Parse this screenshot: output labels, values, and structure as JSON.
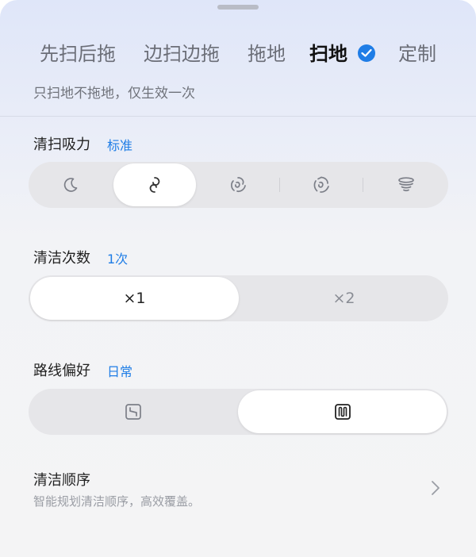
{
  "tabs": [
    {
      "label": "先扫后拖",
      "active": false
    },
    {
      "label": "边扫边拖",
      "active": false
    },
    {
      "label": "拖地",
      "active": false
    },
    {
      "label": "扫地",
      "active": true
    },
    {
      "label": "定制",
      "active": false
    }
  ],
  "mode_hint": "只扫地不拖地，仅生效一次",
  "suction": {
    "label": "清扫吸力",
    "value": "标准",
    "options": [
      {
        "icon": "moon-icon",
        "active": false
      },
      {
        "icon": "swirl-standard-icon",
        "active": true
      },
      {
        "icon": "swirl-strong-icon",
        "active": false
      },
      {
        "icon": "swirl-turbo-icon",
        "active": false
      },
      {
        "icon": "tornado-max-icon",
        "active": false
      }
    ]
  },
  "passes": {
    "label": "清洁次数",
    "value": "1次",
    "options": [
      {
        "label": "×1",
        "active": true
      },
      {
        "label": "×2",
        "active": false
      }
    ]
  },
  "route": {
    "label": "路线偏好",
    "value": "日常",
    "options": [
      {
        "icon": "route-daily-icon",
        "active": false
      },
      {
        "icon": "route-zigzag-icon",
        "active": true
      }
    ]
  },
  "order": {
    "title": "清洁顺序",
    "description": "智能规划清洁顺序，高效覆盖。"
  },
  "colors": {
    "accent": "#1f7de6",
    "text_primary": "#222222",
    "text_secondary": "#70737b"
  }
}
